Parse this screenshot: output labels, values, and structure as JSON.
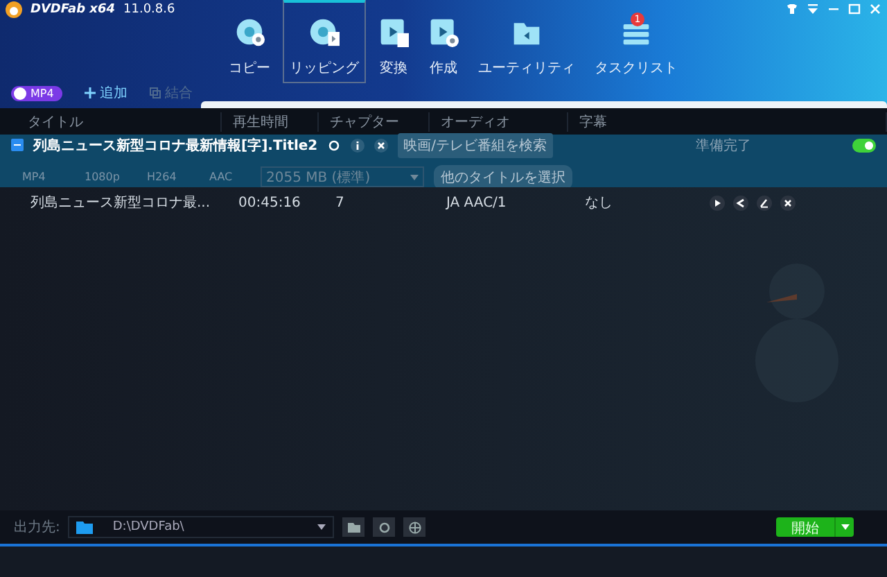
{
  "app": {
    "name": "DVDFab x64",
    "version": "11.0.8.6"
  },
  "nav": [
    {
      "label": "コピー",
      "selected": false
    },
    {
      "label": "リッピング",
      "selected": true
    },
    {
      "label": "変換",
      "selected": false
    },
    {
      "label": "作成",
      "selected": false
    },
    {
      "label": "ユーティリティ",
      "selected": false
    },
    {
      "label": "タスクリスト",
      "selected": false,
      "badge": "1"
    }
  ],
  "toolbar": {
    "profile": "MP4",
    "add": "追加",
    "merge": "結合"
  },
  "columns": [
    "タイトル",
    "再生時間",
    "チャプター",
    "オーディオ",
    "字幕"
  ],
  "title_row": {
    "checked": true,
    "title": "列島ニュース新型コロナ最新情報[字].Title2",
    "search_button": "映画/テレビ番組を検索",
    "status": "準備完了",
    "on": true,
    "specs": [
      "MP4",
      "1080p",
      "H264",
      "AAC"
    ],
    "size": "2055 MB (標準)",
    "other_button": "他のタイトルを選択"
  },
  "rows": [
    {
      "title": "列島ニュース新型コロナ最...",
      "duration": "00:45:16",
      "chapters": "7",
      "audio": "JA AAC/1",
      "subtitle": "なし"
    }
  ],
  "footer": {
    "label": "出力先:",
    "path": "D:\\DVDFab\\",
    "start": "開始"
  }
}
